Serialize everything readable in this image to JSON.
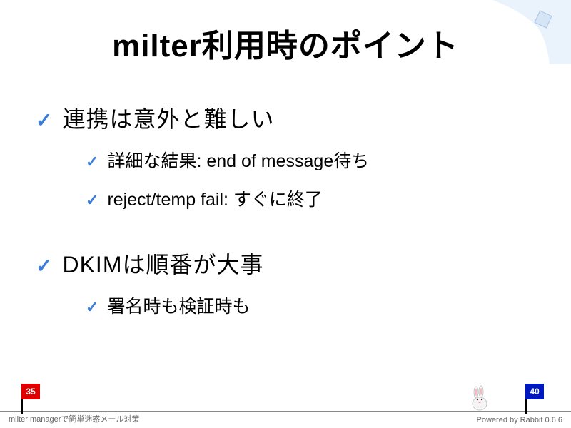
{
  "title": "milter利用時のポイント",
  "bullets": {
    "b1": "連携は意外と難しい",
    "b1s1": "詳細な結果: end of message待ち",
    "b1s2": "reject/temp fail: すぐに終了",
    "b2": "DKIMは順番が大事",
    "b2s1": "署名時も検証時も"
  },
  "footer": {
    "left": "milter managerで簡単迷惑メール対策",
    "right": "Powered by Rabbit 0.6.6"
  },
  "flags": {
    "current": "35",
    "total": "40"
  }
}
